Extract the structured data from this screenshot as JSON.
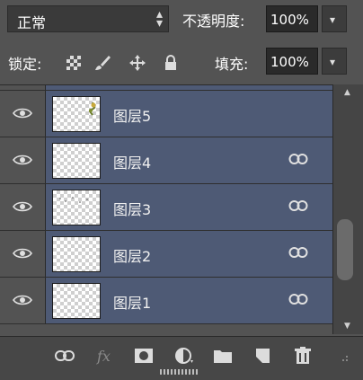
{
  "header": {
    "blend_mode": "正常",
    "opacity_label": "不透明度:",
    "opacity_value": "100%"
  },
  "lock_row": {
    "lock_label": "锁定:",
    "fill_label": "填充:",
    "fill_value": "100%"
  },
  "layers": [
    {
      "name": "图层5",
      "visible": true,
      "linked": false
    },
    {
      "name": "图层4",
      "visible": true,
      "linked": true
    },
    {
      "name": "图层3",
      "visible": true,
      "linked": true
    },
    {
      "name": "图层2",
      "visible": true,
      "linked": true
    },
    {
      "name": "图层1",
      "visible": true,
      "linked": true
    }
  ],
  "icons": {
    "link": "link-layers-icon",
    "fx": "fx",
    "mask": "add-mask-icon",
    "adjust": "adjustment-layer-icon",
    "group": "folder-icon",
    "new": "new-layer-icon",
    "delete": "trash-icon"
  },
  "colors": {
    "selected_row": "#4e5a75",
    "panel_bg": "#535353"
  }
}
